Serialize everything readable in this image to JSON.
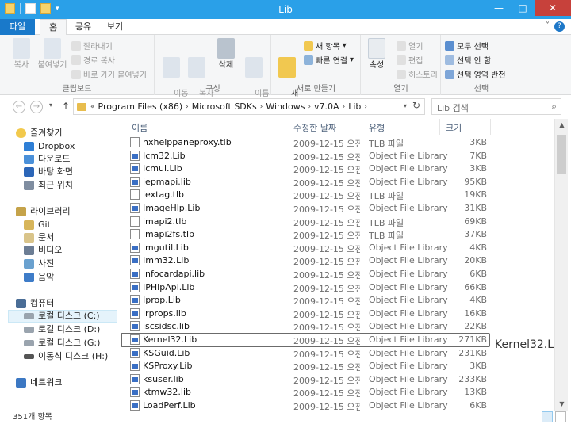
{
  "window": {
    "title": "Lib"
  },
  "ribbon_tabs": [
    {
      "label": "파일"
    },
    {
      "label": "홈"
    },
    {
      "label": "공유"
    },
    {
      "label": "보기"
    }
  ],
  "ribbon": {
    "clipboard": {
      "copy": "복사",
      "paste": "붙여넣기",
      "cut": "잘라내기",
      "copy_path": "경로 복사",
      "paste_shortcut": "바로 가기 붙여넣기",
      "label": "클립보드"
    },
    "organize": {
      "move_to": "이동\n위치",
      "copy_to": "복사\n위치",
      "delete": "삭제",
      "rename": "이름\n바꾸기",
      "label": "구성"
    },
    "new": {
      "new_folder": "새\n폴더",
      "new_item": "새 항목",
      "easy_access": "빠른 연결",
      "label": "새로 만들기"
    },
    "open": {
      "properties": "속성",
      "open": "열기",
      "edit": "편집",
      "history": "히스토리",
      "label": "열기"
    },
    "select": {
      "select_all": "모두 선택",
      "select_none": "선택 안 함",
      "invert": "선택 영역 반전",
      "label": "선택"
    }
  },
  "address": {
    "crumbs": [
      "Program Files (x86)",
      "Microsoft SDKs",
      "Windows",
      "v7.0A",
      "Lib"
    ],
    "prefix": "«"
  },
  "search": {
    "placeholder": "Lib 검색"
  },
  "nav": {
    "favorites": "즐겨찾기",
    "fav_items": [
      "Dropbox",
      "다운로드",
      "바탕 화면",
      "최근 위치"
    ],
    "libraries": "라이브러리",
    "lib_items": [
      "Git",
      "문서",
      "비디오",
      "사진",
      "음악"
    ],
    "computer": "컴퓨터",
    "drives": [
      "로컬 디스크 (C:)",
      "로컬 디스크 (D:)",
      "로컬 디스크 (G:)",
      "이동식 디스크 (H:)"
    ],
    "network": "네트워크"
  },
  "columns": {
    "name": "이름",
    "date": "수정한 날짜",
    "type": "유형",
    "size": "크기"
  },
  "files": [
    {
      "name": "hxhelppaneproxy.tlb",
      "date": "2009-12-15 오전...",
      "type": "TLB 파일",
      "size": "3KB",
      "icon": "file-icon"
    },
    {
      "name": "Icm32.Lib",
      "date": "2009-12-15 오전...",
      "type": "Object File Library",
      "size": "7KB",
      "icon": "lib-icon"
    },
    {
      "name": "Icmui.Lib",
      "date": "2009-12-15 오전...",
      "type": "Object File Library",
      "size": "3KB",
      "icon": "lib-icon"
    },
    {
      "name": "iepmapi.lib",
      "date": "2009-12-15 오전...",
      "type": "Object File Library",
      "size": "95KB",
      "icon": "lib-icon"
    },
    {
      "name": "iextag.tlb",
      "date": "2009-12-15 오전...",
      "type": "TLB 파일",
      "size": "19KB",
      "icon": "file-icon"
    },
    {
      "name": "ImageHlp.Lib",
      "date": "2009-12-15 오전...",
      "type": "Object File Library",
      "size": "31KB",
      "icon": "lib-icon"
    },
    {
      "name": "imapi2.tlb",
      "date": "2009-12-15 오전...",
      "type": "TLB 파일",
      "size": "69KB",
      "icon": "file-icon"
    },
    {
      "name": "imapi2fs.tlb",
      "date": "2009-12-15 오전...",
      "type": "TLB 파일",
      "size": "37KB",
      "icon": "file-icon"
    },
    {
      "name": "imgutil.Lib",
      "date": "2009-12-15 오전...",
      "type": "Object File Library",
      "size": "4KB",
      "icon": "lib-icon"
    },
    {
      "name": "Imm32.Lib",
      "date": "2009-12-15 오전...",
      "type": "Object File Library",
      "size": "20KB",
      "icon": "lib-icon"
    },
    {
      "name": "infocardapi.lib",
      "date": "2009-12-15 오전...",
      "type": "Object File Library",
      "size": "6KB",
      "icon": "lib-icon"
    },
    {
      "name": "IPHlpApi.Lib",
      "date": "2009-12-15 오전...",
      "type": "Object File Library",
      "size": "66KB",
      "icon": "lib-icon"
    },
    {
      "name": "Iprop.Lib",
      "date": "2009-12-15 오전...",
      "type": "Object File Library",
      "size": "4KB",
      "icon": "lib-icon"
    },
    {
      "name": "irprops.lib",
      "date": "2009-12-15 오전...",
      "type": "Object File Library",
      "size": "16KB",
      "icon": "lib-icon"
    },
    {
      "name": "iscsidsc.lib",
      "date": "2009-12-15 오전...",
      "type": "Object File Library",
      "size": "22KB",
      "icon": "lib-icon"
    },
    {
      "name": "Kernel32.Lib",
      "date": "2009-12-15 오전...",
      "type": "Object File Library",
      "size": "271KB",
      "icon": "lib-icon",
      "highlight": true
    },
    {
      "name": "KSGuid.Lib",
      "date": "2009-12-15 오전...",
      "type": "Object File Library",
      "size": "231KB",
      "icon": "lib-icon"
    },
    {
      "name": "KSProxy.Lib",
      "date": "2009-12-15 오전...",
      "type": "Object File Library",
      "size": "3KB",
      "icon": "lib-icon"
    },
    {
      "name": "ksuser.lib",
      "date": "2009-12-15 오전...",
      "type": "Object File Library",
      "size": "233KB",
      "icon": "lib-icon"
    },
    {
      "name": "ktmw32.lib",
      "date": "2009-12-15 오전...",
      "type": "Object File Library",
      "size": "13KB",
      "icon": "lib-icon"
    },
    {
      "name": "LoadPerf.Lib",
      "date": "2009-12-15 오전...",
      "type": "Object File Library",
      "size": "6KB",
      "icon": "lib-icon"
    }
  ],
  "callout": "Kernel32.Lib",
  "status": {
    "count": "351개 항목"
  }
}
